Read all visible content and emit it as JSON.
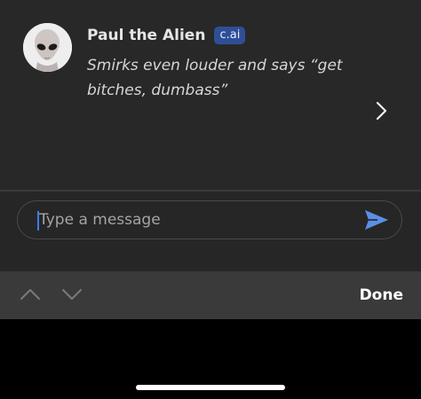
{
  "message": {
    "sender": "Paul the Alien",
    "badge": "c.ai",
    "text": "Smirks even louder and says “get bitches, dumbass”"
  },
  "icons": {
    "avatar": "alien-avatar",
    "next": "chevron-right-icon",
    "send": "send-icon",
    "up": "chevron-up-icon",
    "down": "chevron-down-icon"
  },
  "input": {
    "placeholder": "Type a message"
  },
  "toolbar": {
    "done_label": "Done"
  },
  "colors": {
    "badge": "#2e4f95",
    "send": "#5b8fe6",
    "cursor": "#3b7cf0"
  }
}
